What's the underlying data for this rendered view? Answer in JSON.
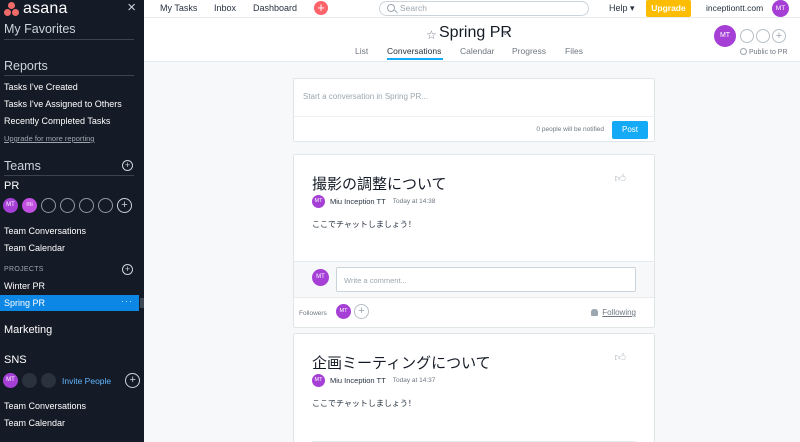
{
  "sidebar": {
    "logo": "asana",
    "close": "×",
    "favorites_header": "My Favorites",
    "reports_header": "Reports",
    "reports": [
      "Tasks I've Created",
      "Tasks I've Assigned to Others",
      "Recently Completed Tasks"
    ],
    "upgrade_link": "Upgrade for more reporting",
    "teams_header": "Teams",
    "pr_team": {
      "name": "PR",
      "members": [
        "MT",
        "mi"
      ],
      "links": [
        "Team Conversations",
        "Team Calendar"
      ],
      "projects_label": "PROJECTS",
      "projects": [
        "Winter PR",
        "Spring PR"
      ],
      "active_dots": "···"
    },
    "marketing_team": "Marketing",
    "sns_team": {
      "name": "SNS",
      "members": [
        "MT"
      ],
      "invite": "Invite People",
      "links": [
        "Team Conversations",
        "Team Calendar"
      ]
    }
  },
  "topbar": {
    "nav": [
      "My Tasks",
      "Inbox",
      "Dashboard"
    ],
    "quick_add": "+",
    "search_placeholder": "Search",
    "help": "Help ▾",
    "upgrade": "Upgrade",
    "domain": "inceptiontt.com",
    "avatar": "MT"
  },
  "project": {
    "star": "☆",
    "title": "Spring PR",
    "caret": "⌄",
    "tabs": [
      "List",
      "Conversations",
      "Calendar",
      "Progress",
      "Files"
    ],
    "active_tab": "Conversations",
    "member_avatar": "MT",
    "member_plus": "+",
    "public_label": "Public to PR"
  },
  "composer": {
    "placeholder": "Start a conversation in Spring PR...",
    "notify": "0 people will be notified",
    "post": "Post"
  },
  "conversations": [
    {
      "title": "撮影の調整について",
      "author_avatar": "MT",
      "author": "Miu Inception TT",
      "time": "Today at 14:38",
      "body": "ここでチャットしましょう！",
      "comment_avatar": "MT",
      "comment_placeholder": "Write a comment...",
      "followers_label": "Followers",
      "follower_avatar": "MT",
      "following": "Following"
    },
    {
      "title": "企画ミーティングについて",
      "author_avatar": "MT",
      "author": "Miu Inception TT",
      "time": "Today at 14:37",
      "body": "ここでチャットしましょう！"
    }
  ],
  "colors": {
    "sidebar_bg": "#151b26",
    "active_blue": "#0d87e6",
    "accent": "#14aaf5",
    "upgrade": "#fcbd01",
    "avatar": "#a53fd6",
    "quick_add": "#fc636b"
  }
}
